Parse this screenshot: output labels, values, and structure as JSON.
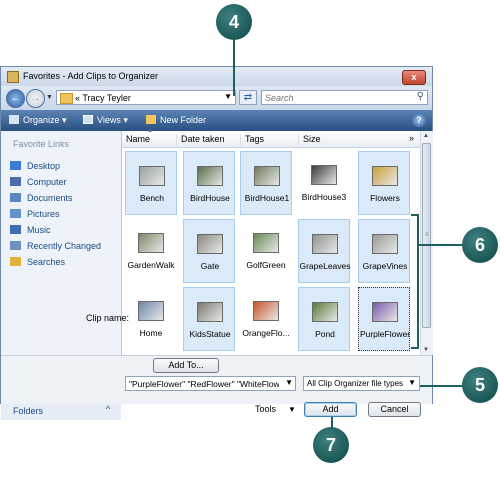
{
  "window": {
    "title": "Favorites - Add Clips to Organizer",
    "close_glyph": "x"
  },
  "address": {
    "prefix": "«",
    "location": "Tracy Teyler",
    "search_placeholder": "Search"
  },
  "toolbar": {
    "organize": "Organize",
    "views": "Views",
    "new_folder": "New Folder",
    "help": "?"
  },
  "nav": {
    "header": "Favorite Links",
    "items": [
      {
        "label": "Desktop",
        "icon": "desktop-icon",
        "color": "#3a7bd5"
      },
      {
        "label": "Computer",
        "icon": "computer-icon",
        "color": "#4a6fa8"
      },
      {
        "label": "Documents",
        "icon": "documents-icon",
        "color": "#5b86c2"
      },
      {
        "label": "Pictures",
        "icon": "pictures-icon",
        "color": "#5f93c9"
      },
      {
        "label": "Music",
        "icon": "music-icon",
        "color": "#3d6db3"
      },
      {
        "label": "Recently Changed",
        "icon": "recent-icon",
        "color": "#6f8fbf"
      },
      {
        "label": "Searches",
        "icon": "searches-icon",
        "color": "#e0b33f"
      }
    ],
    "folders": "Folders",
    "folders_chevron": "^"
  },
  "columns": [
    "Name",
    "Date taken",
    "Tags",
    "Size"
  ],
  "more_columns": "»",
  "files": [
    {
      "name": "Bench",
      "selected": true,
      "color": "#9aa0a0"
    },
    {
      "name": "BirdHouse",
      "selected": true,
      "color": "#5b6b4a"
    },
    {
      "name": "BirdHouse1",
      "selected": true,
      "color": "#6f7d5c"
    },
    {
      "name": "BirdHouse3",
      "selected": false,
      "color": "#3a3a3a"
    },
    {
      "name": "Flowers",
      "selected": true,
      "color": "#c9a13a"
    },
    {
      "name": "GardenWalk",
      "selected": false,
      "color": "#7d8a6a"
    },
    {
      "name": "Gate",
      "selected": true,
      "color": "#8a8a80"
    },
    {
      "name": "GolfGreen",
      "selected": false,
      "color": "#6a8a5a"
    },
    {
      "name": "GrapeLeaves",
      "selected": true,
      "color": "#8f9590"
    },
    {
      "name": "GrapeVines",
      "selected": true,
      "color": "#9a9a95"
    },
    {
      "name": "Home",
      "selected": false,
      "color": "#6f86a8"
    },
    {
      "name": "KidsStatue",
      "selected": true,
      "color": "#7a7a70"
    },
    {
      "name": "OrangeFlo...",
      "selected": false,
      "color": "#c9562a"
    },
    {
      "name": "Pond",
      "selected": true,
      "color": "#5c7a3a"
    },
    {
      "name": "PurpleFlower",
      "selected": true,
      "focused": true,
      "color": "#7a5aa8"
    }
  ],
  "bottom": {
    "add_to": "Add To...",
    "clip_name_label": "Clip name:",
    "clip_name_value": "\"PurpleFlower\" \"RedFlower\" \"WhiteFlower\" \"",
    "file_type": "All Clip Organizer file types",
    "tools": "Tools",
    "add": "Add",
    "cancel": "Cancel"
  },
  "callouts": {
    "c4": "4",
    "c5": "5",
    "c6": "6",
    "c7": "7"
  },
  "colors": {
    "callout": "#1e5f5f",
    "toolbar": "#3b6597",
    "selection": "#dbeaf8"
  }
}
